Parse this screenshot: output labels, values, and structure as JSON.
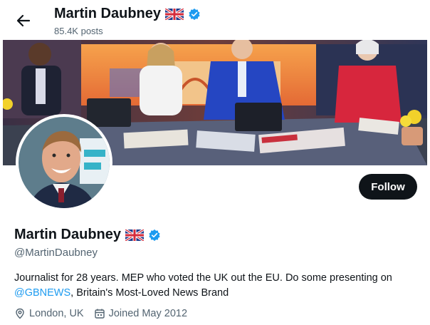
{
  "header": {
    "display_name": "Martin Daubney",
    "posts_count": "85.4K posts"
  },
  "profile": {
    "display_name": "Martin Daubney",
    "handle": "@MartinDaubney",
    "follow_label": "Follow",
    "bio_text_before": "Journalist for 28 years. MEP who voted the UK out the EU. Do some presenting on ",
    "bio_mention": "@GBNEWS",
    "bio_text_after": ", Britain's Most-Loved News Brand",
    "location": "London, UK",
    "joined": "Joined May 2012"
  },
  "icons": {
    "back": "back-arrow-icon",
    "verified": "verified-badge-icon",
    "flag": "uk-flag-icon",
    "location": "location-pin-icon",
    "calendar": "calendar-icon"
  },
  "colors": {
    "accent": "#1d9bf0",
    "text": "#0f1419",
    "secondary_text": "#536471",
    "follow_button": "#0f1419"
  }
}
